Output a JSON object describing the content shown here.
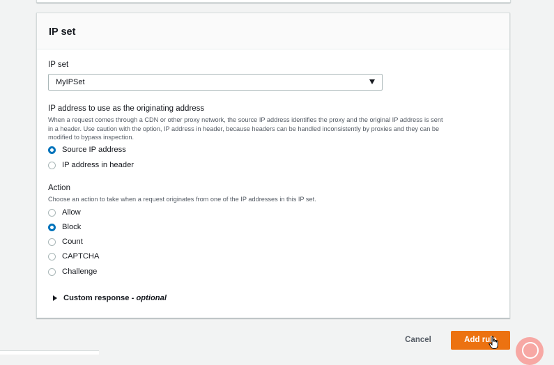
{
  "panel": {
    "title": "IP set",
    "ip_set": {
      "label": "IP set",
      "selected": "MyIPSet"
    },
    "originating_address": {
      "label": "IP address to use as the originating address",
      "description_lines": [
        "When a request comes through a CDN or other proxy network, the source IP address identifies the proxy and the original IP address is sent",
        "in a header. Use caution with the option, IP address in header, because headers can be handled inconsistently by proxies and they can be",
        "modified to bypass inspection."
      ],
      "options": [
        {
          "label": "Source IP address",
          "checked": true
        },
        {
          "label": "IP address in header",
          "checked": false
        }
      ]
    },
    "action": {
      "label": "Action",
      "description": "Choose an action to take when a request originates from one of the IP addresses in this IP set.",
      "options": [
        {
          "label": "Allow",
          "checked": false
        },
        {
          "label": "Block",
          "checked": true
        },
        {
          "label": "Count",
          "checked": false
        },
        {
          "label": "CAPTCHA",
          "checked": false
        },
        {
          "label": "Challenge",
          "checked": false
        }
      ]
    },
    "custom_response": {
      "label": "Custom response",
      "separator": " - ",
      "optional": "optional"
    }
  },
  "footer": {
    "cancel_label": "Cancel",
    "add_rule_label": "Add rule"
  },
  "colors": {
    "primary": "#ec7211",
    "radio_checked": "#0073bb"
  },
  "icons": {
    "select_caret": "caret-down-icon",
    "expander": "caret-right-icon",
    "cursor": "hand-pointer-icon"
  }
}
